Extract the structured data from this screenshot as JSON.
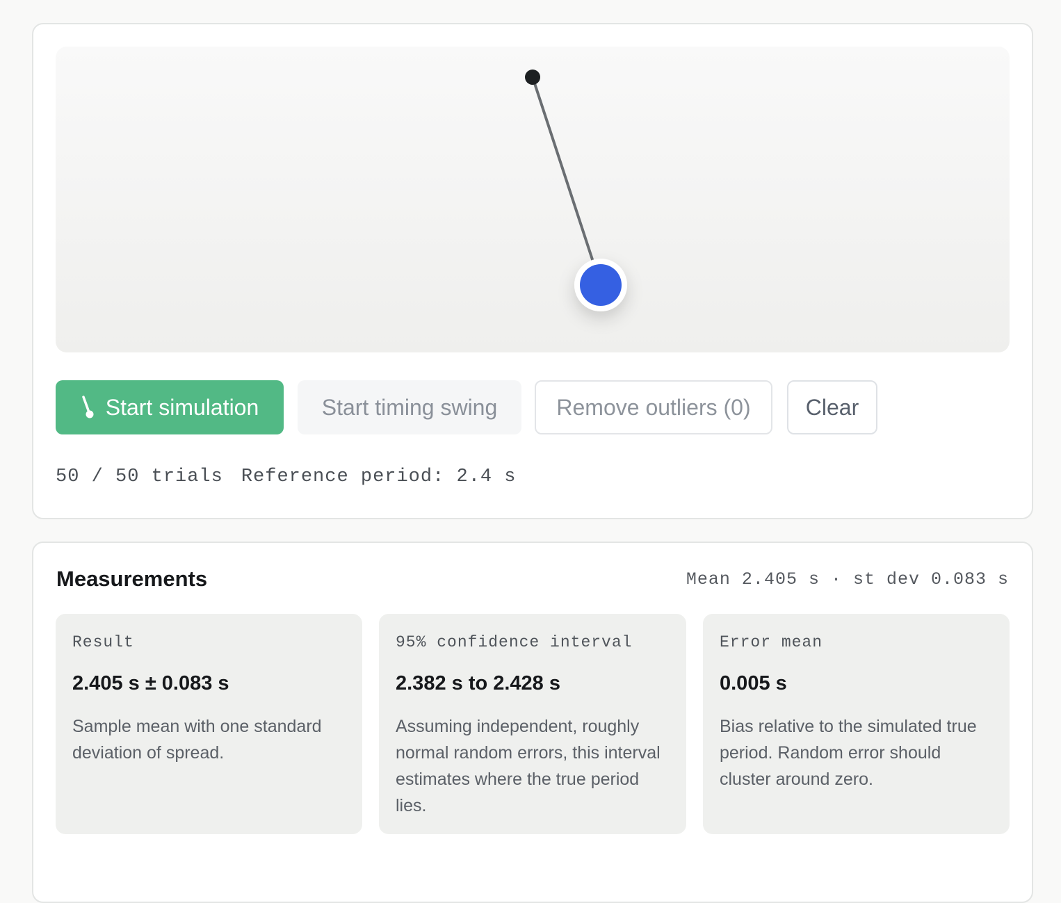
{
  "controls": {
    "start_simulation": "Start simulation",
    "start_simulation_icon": "pendulum-icon",
    "start_timing": "Start timing swing",
    "remove_outliers": "Remove outliers (0)",
    "clear": "Clear"
  },
  "status": {
    "trials": "50 / 50 trials",
    "reference": "Reference period: 2.4 s"
  },
  "measurements": {
    "title": "Measurements",
    "summary": "Mean 2.405 s · st dev 0.083 s",
    "cards": [
      {
        "label": "Result",
        "value": "2.405 s ± 0.083 s",
        "description": "Sample mean with one standard deviation of spread."
      },
      {
        "label": "95% confidence interval",
        "value": "2.382 s to 2.428 s",
        "description": "Assuming independent, roughly normal random errors, this interval estimates where the true period lies."
      },
      {
        "label": "Error mean",
        "value": "0.005 s",
        "description": "Bias relative to the simulated true period. Random error should cluster around zero."
      }
    ]
  },
  "colors": {
    "bob": "#3461e2",
    "primary_button": "#52b985",
    "string": "#6a6e72",
    "pivot": "#1d2022"
  }
}
